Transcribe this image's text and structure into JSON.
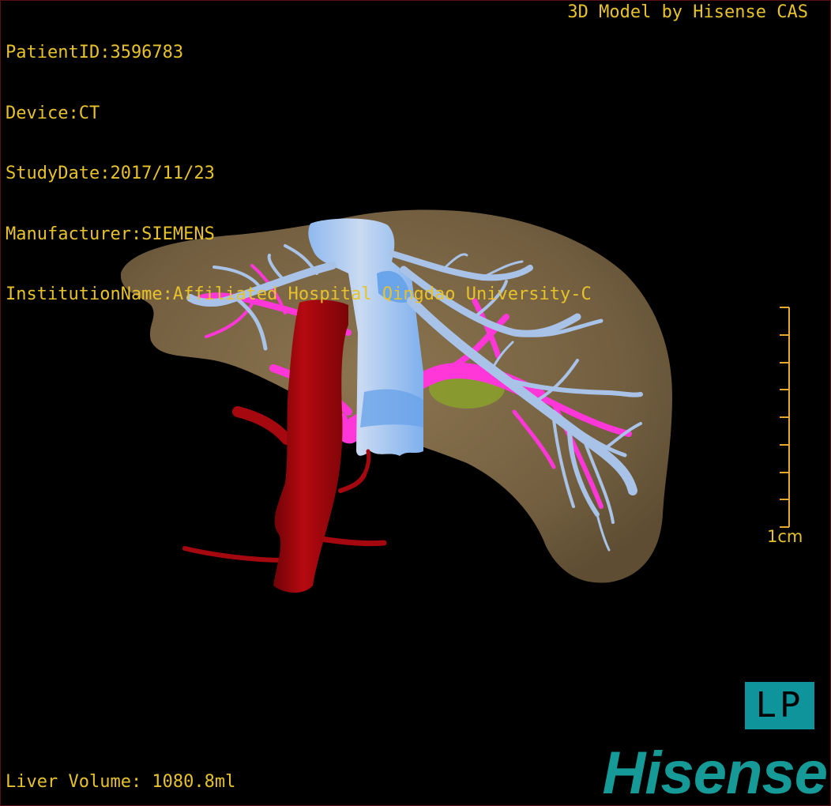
{
  "patient_info": {
    "patient_id": "PatientID:3596783",
    "device": "Device:CT",
    "study_date": "StudyDate:2017/11/23",
    "manufacturer": "Manufacturer:SIEMENS",
    "institution": "InstitutionName:Affiliated Hospital Qingdao University-C"
  },
  "model_credit": "3D Model by Hisense CAS",
  "scale_bar": {
    "label": "1cm",
    "tick_count": 9
  },
  "orientation_label": "LP",
  "liver_volume": "Liver Volume: 1080.8ml",
  "brand": "Hisense",
  "colors": {
    "overlay_text": "#e7c22b",
    "liver": "#7d6848",
    "hepatic_vein": "#a9c3e8",
    "vena_cava": "#7fb2ee",
    "portal_vein": "#ff36d8",
    "artery": "#a5080e",
    "gallbladder": "#8aa12c",
    "brand": "#159a98"
  }
}
